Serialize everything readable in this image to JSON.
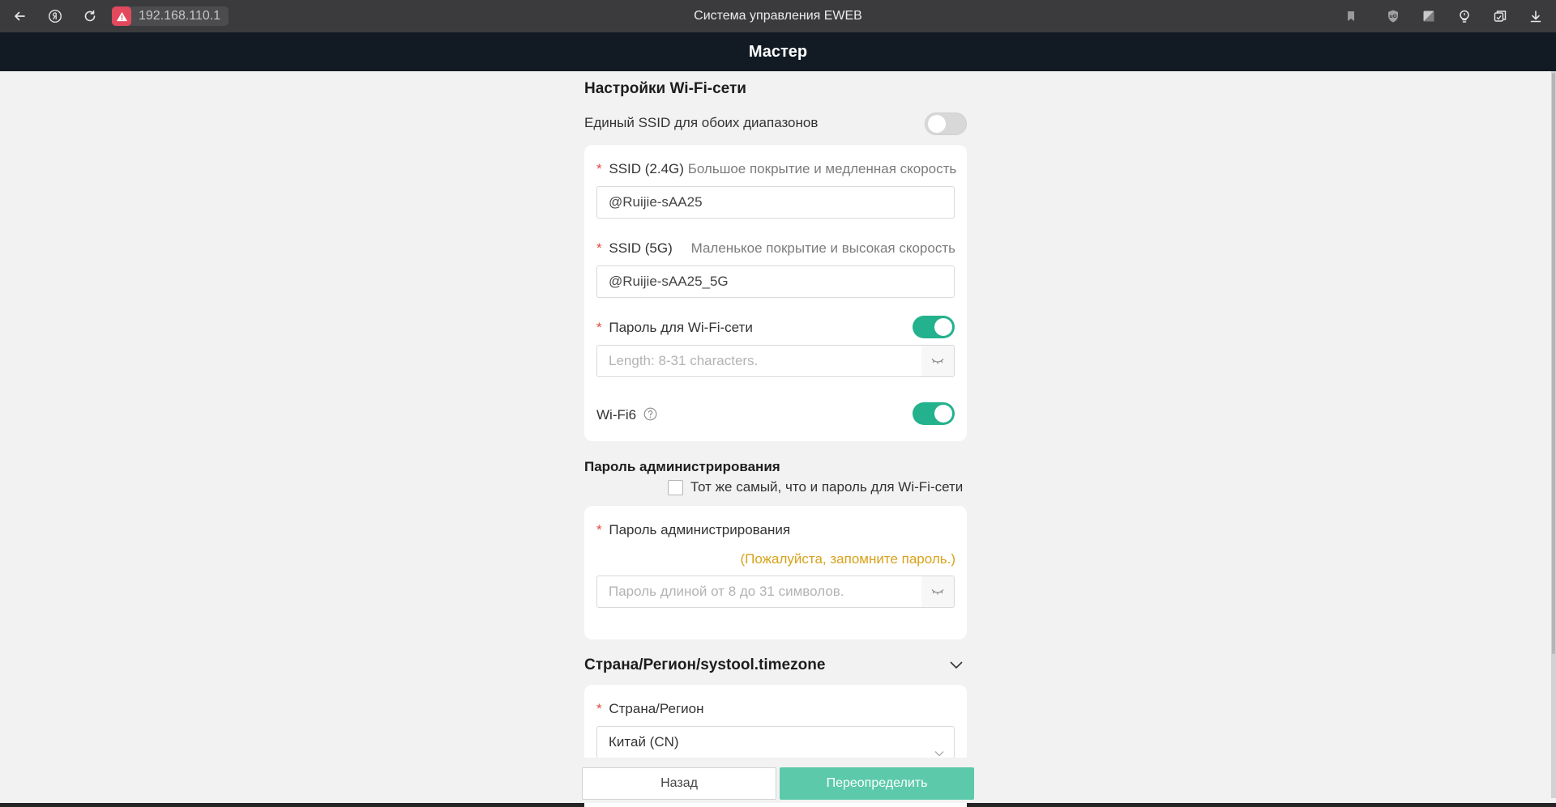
{
  "browser": {
    "address": "192.168.110.1",
    "window_title": "Система управления EWEB",
    "icons": [
      "back-arrow-icon",
      "yandex-icon",
      "reload-icon",
      "warning-icon",
      "bookmark-icon",
      "ublock-icon",
      "extension-icon",
      "lightbulb-icon",
      "tabs-icon",
      "download-icon"
    ]
  },
  "header": {
    "title": "Мастер"
  },
  "wifi": {
    "section_title": "Настройки Wi-Fi-сети",
    "unified_ssid_label": "Единый SSID для обоих диапазонов",
    "unified_ssid_on": false,
    "ssid24": {
      "label": "SSID (2.4G)",
      "hint": "Большое покрытие и медленная скорость",
      "value": "@Ruijie-sAA25"
    },
    "ssid5": {
      "label": "SSID (5G)",
      "hint": "Маленькое покрытие и высокая скорость",
      "value": "@Ruijie-sAA25_5G"
    },
    "password": {
      "label": "Пароль для Wi-Fi-сети",
      "placeholder": "Length: 8-31 characters.",
      "enabled": true
    },
    "wifi6": {
      "label": "Wi-Fi6",
      "enabled": true
    }
  },
  "admin": {
    "section_title": "Пароль администрирования",
    "same_as_wifi_label": "Тот же самый, что и пароль для Wi-Fi-сети",
    "same_as_wifi_checked": false,
    "password_label": "Пароль администрирования",
    "reminder": "(Пожалуйста, запомните пароль.)",
    "placeholder": "Пароль длиной от 8 до 31 символов."
  },
  "region": {
    "section_title": "Страна/Регион/systool.timezone",
    "country_label": "Страна/Регион",
    "country_value": "Китай (CN)"
  },
  "required_mark": "*",
  "buttons": {
    "back": "Назад",
    "next": "Переопределить"
  },
  "colors": {
    "accent": "#23b28d",
    "primary_button": "#5ccaaa",
    "required": "#e3493e",
    "warning": "#d8a11a",
    "header_bg": "#121b23"
  }
}
